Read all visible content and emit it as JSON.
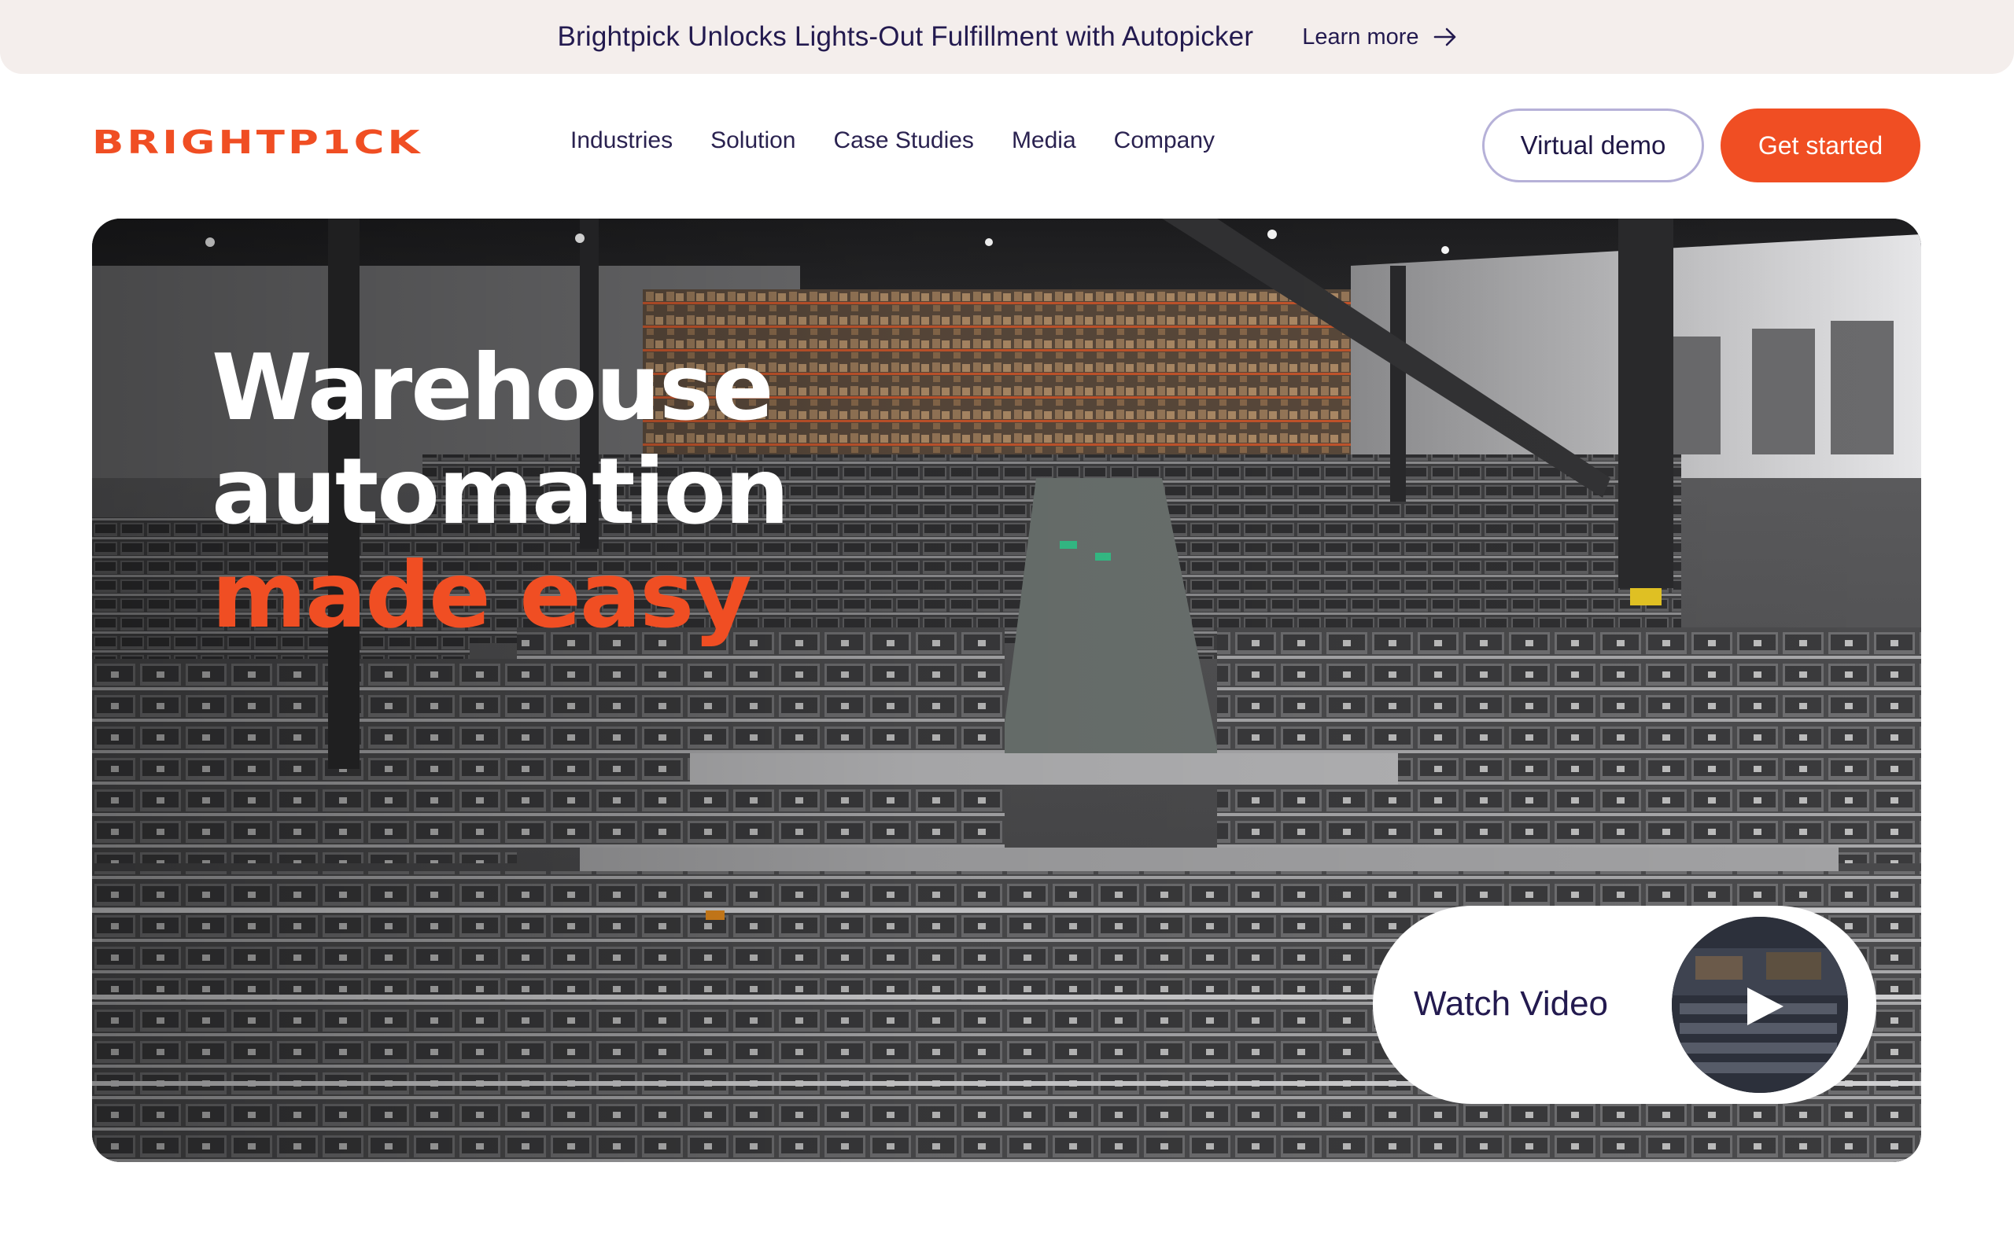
{
  "announcement": {
    "text": "Brightpick Unlocks Lights-Out Fulfillment with Autopicker",
    "link_label": "Learn more",
    "link_icon": "arrow-right-icon"
  },
  "header": {
    "logo_text": "BRIGHTP1CK",
    "nav": [
      {
        "label": "Industries"
      },
      {
        "label": "Solution"
      },
      {
        "label": "Case Studies"
      },
      {
        "label": "Media"
      },
      {
        "label": "Company"
      }
    ],
    "virtual_demo_label": "Virtual demo",
    "get_started_label": "Get started"
  },
  "hero": {
    "title_line1": "Warehouse",
    "title_line2": "automation",
    "title_accent": "made easy",
    "watch_video_label": "Watch Video",
    "play_icon": "play-icon"
  },
  "colors": {
    "brand_orange": "#f04e23",
    "navy_text": "#231a4f",
    "announce_bg": "#f4eeec",
    "demo_border": "#b6b1d8"
  }
}
